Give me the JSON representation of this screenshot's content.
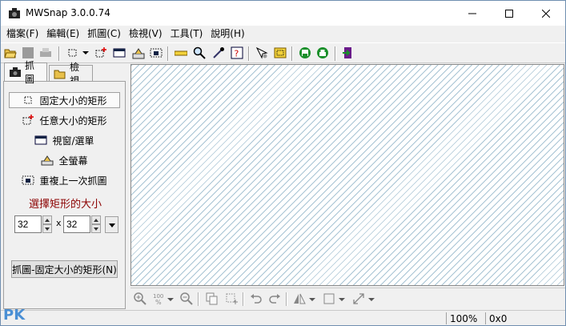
{
  "window": {
    "title": "MWSnap 3.0.0.74"
  },
  "menu": [
    "檔案(F)",
    "編輯(E)",
    "抓圖(C)",
    "檢視(V)",
    "工具(T)",
    "說明(H)"
  ],
  "tabs": {
    "capture": "抓圖",
    "view": "檢視"
  },
  "capture_modes": [
    {
      "label": "固定大小的矩形",
      "icon": "fixed-rectangle-icon",
      "selected": true
    },
    {
      "label": "任意大小的矩形",
      "icon": "any-rectangle-icon",
      "selected": false
    },
    {
      "label": "視窗/選單",
      "icon": "window-menu-icon",
      "selected": false
    },
    {
      "label": "全螢幕",
      "icon": "full-screen-icon",
      "selected": false
    },
    {
      "label": "重複上一次抓圖",
      "icon": "repeat-capture-icon",
      "selected": false
    }
  ],
  "size": {
    "label": "選擇矩形的大小",
    "width": "32",
    "height": "32",
    "times": "x"
  },
  "capture_button": "抓圖-固定大小的矩形(N)",
  "status": {
    "zoom": "100%",
    "coords": "0x0"
  },
  "watermark": "PK",
  "colors": {
    "label_red": "#8b0000",
    "canvas_stripe": "#a8c4d4",
    "accent_green": "#1a8f2a"
  }
}
